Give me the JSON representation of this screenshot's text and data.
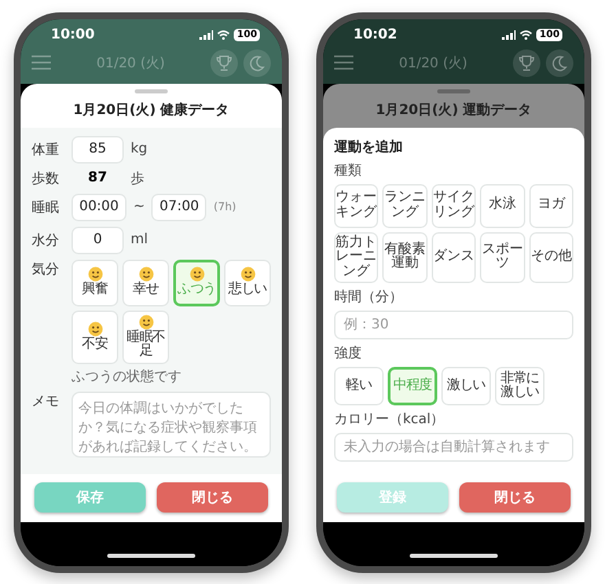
{
  "health_phone": {
    "status_bar": {
      "time": "10:00",
      "battery": "100"
    },
    "app_header": {
      "date": "01/20 (火)"
    },
    "sheet": {
      "title": "1月20日(火) 健康データ",
      "weight": {
        "label": "体重",
        "value": "85",
        "unit": "kg"
      },
      "steps": {
        "label": "歩数",
        "value": "87",
        "unit": "歩"
      },
      "sleep": {
        "label": "睡眠",
        "start": "00:00",
        "separator": "~",
        "end": "07:00",
        "duration": "(7h)"
      },
      "water": {
        "label": "水分",
        "value": "0",
        "unit": "ml"
      },
      "mood": {
        "label": "気分",
        "options": [
          {
            "label": "興奮",
            "selected": false
          },
          {
            "label": "幸せ",
            "selected": false
          },
          {
            "label": "ふつう",
            "selected": true
          },
          {
            "label": "悲しい",
            "selected": false
          },
          {
            "label": "不安",
            "selected": false
          },
          {
            "label": "睡眠不足",
            "selected": false
          }
        ],
        "hint": "ふつうの状態です"
      },
      "memo": {
        "label": "メモ",
        "placeholder": "今日の体調はいかがでしたか？気になる症状や観察事項があれば記録してください。"
      },
      "buttons": [
        {
          "label": "保存",
          "kind": "save",
          "disabled": false
        },
        {
          "label": "閉じる",
          "kind": "close",
          "disabled": false
        }
      ]
    }
  },
  "exercise_phone": {
    "status_bar": {
      "time": "10:02",
      "battery": "100"
    },
    "app_header": {
      "date": "01/20 (火)"
    },
    "sheet": {
      "title": "1月20日(火) 運動データ",
      "form": {
        "heading": "運動を追加",
        "type": {
          "label": "種類",
          "options": [
            {
              "label": "ウォーキング",
              "selected": false
            },
            {
              "label": "ランニング",
              "selected": false
            },
            {
              "label": "サイクリング",
              "selected": false
            },
            {
              "label": "水泳",
              "selected": false
            },
            {
              "label": "ヨガ",
              "selected": false
            },
            {
              "label": "筋力トレーニング",
              "selected": false
            },
            {
              "label": "有酸素運動",
              "selected": false
            },
            {
              "label": "ダンス",
              "selected": false
            },
            {
              "label": "スポーツ",
              "selected": false
            },
            {
              "label": "その他",
              "selected": false
            }
          ]
        },
        "duration": {
          "label": "時間（分）",
          "placeholder": "例：30"
        },
        "intensity": {
          "label": "強度",
          "options": [
            {
              "label": "軽い",
              "selected": false
            },
            {
              "label": "中程度",
              "selected": true
            },
            {
              "label": "激しい",
              "selected": false
            },
            {
              "label": "非常に激しい",
              "selected": false
            }
          ]
        },
        "calories": {
          "label": "カロリー（kcal）",
          "placeholder": "未入力の場合は自動計算されます"
        }
      },
      "buttons": [
        {
          "label": "登録",
          "kind": "save",
          "disabled": true
        },
        {
          "label": "閉じる",
          "kind": "close",
          "disabled": false
        }
      ]
    }
  }
}
